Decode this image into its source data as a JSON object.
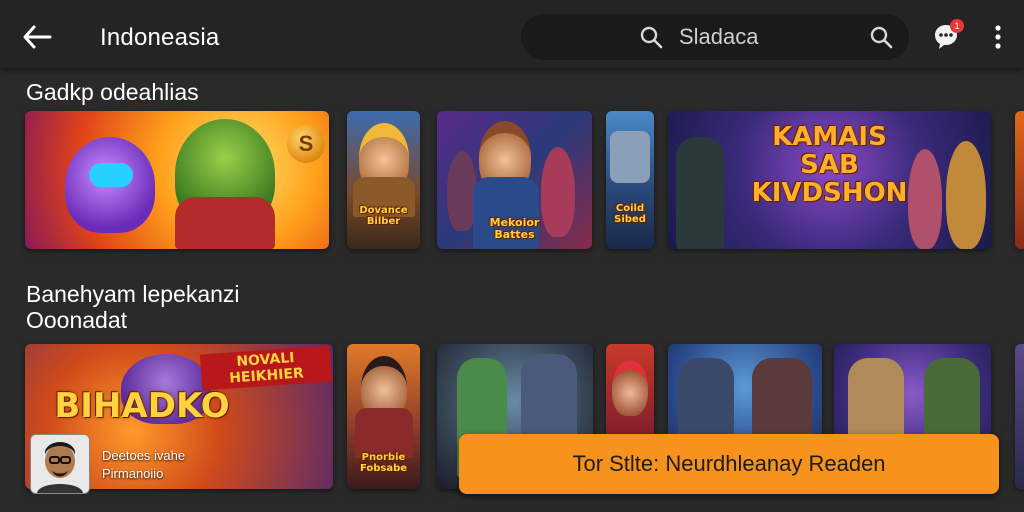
{
  "header": {
    "title": "Indoneasia",
    "search_placeholder": "Sladaca",
    "notification_badge": "1",
    "icons": [
      "arrow-left-icon",
      "search-icon",
      "chat-bubble-icon",
      "more-vert-icon"
    ]
  },
  "section1": {
    "title": "Gadkp odeahlias",
    "cards": [
      {
        "label": "",
        "coin": "S"
      },
      {
        "label": "Dovance\nBilber"
      },
      {
        "label": "Mekoior\nBattes"
      },
      {
        "label": "Coild\nSibed"
      },
      {
        "label": "KAMAIS\nSAB\nKIVDSHON"
      }
    ]
  },
  "section2": {
    "title_line1": "Banehyam lepekanzi",
    "title_line2": "Ooonadat",
    "cards": [
      {
        "label": "BIHADKO",
        "banner": "NOVALI\nHEIKHIER"
      },
      {
        "label": "Pnorbie\nFobsabe"
      },
      {
        "label": ""
      },
      {
        "label": ""
      },
      {
        "label": ""
      },
      {
        "label": ""
      }
    ]
  },
  "user": {
    "line1": "Deetoes ivahe",
    "line2": "Pirmanoiio"
  },
  "toast": {
    "text": "Tor Stlte: Neurdhleanay Readen"
  },
  "colors": {
    "accent": "#f7921c",
    "background": "#2a2a2b",
    "topbar": "#242425"
  }
}
